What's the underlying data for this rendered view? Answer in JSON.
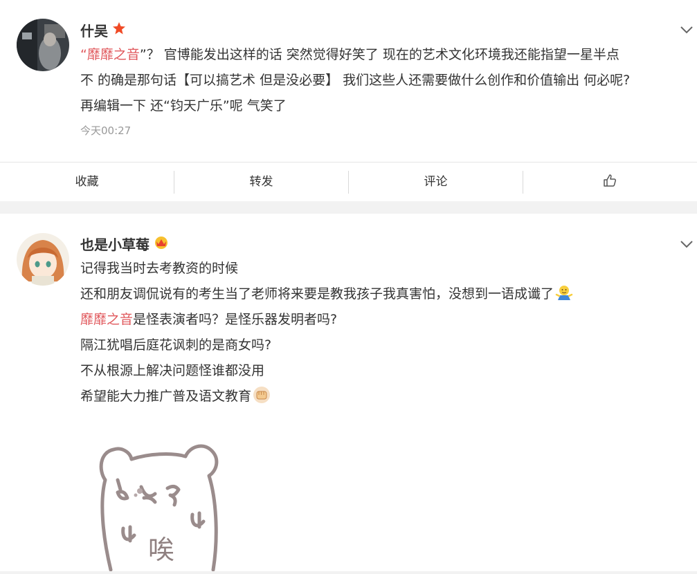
{
  "comments": [
    {
      "user": "什吴",
      "badge_icon": "star-badge-icon",
      "text_lines": [
        {
          "open_quote": "“",
          "mention": "靡靡之音",
          "rest": "”？ 官博能发出这样的话 突然觉得好笑了 现在的艺术文化环境我还能指望一星半点"
        },
        {
          "rest": "不 的确是那句话【可以搞艺术 但是没必要】 我们这些人还需要做什么创作和价值输出 何必呢?"
        },
        {
          "rest": "再编辑一下 还“钧天广乐”呢 气笑了"
        }
      ],
      "time": "今天00:27",
      "actions": {
        "collect": "收藏",
        "forward": "转发",
        "comment": "评论",
        "like_icon": "thumbs-up-icon"
      }
    },
    {
      "user": "也是小草莓",
      "badge_icon": "crown-badge-icon",
      "text_lines": [
        "记得我当时去考教资的时候",
        "还和朋友调侃说有的考生当了老师将来要是教我孩子我真害怕，没想到一语成谶了",
        {
          "mention": "靡靡之音",
          "rest": "是怪表演者吗？是怪乐器发明者吗?"
        },
        "隔江犹唱后庭花讽刺的是商女吗?",
        "不从根源上解决问题怪谁都没用",
        "希望能大力推广普及语文教育"
      ],
      "emoji_1": "shrug-emoji-icon",
      "emoji_2": "fist-emoji-icon",
      "sticker_text": "唉",
      "sticker_icon": "bear-sticker-icon"
    }
  ],
  "colors": {
    "mention": "#e0575b",
    "time": "#999999",
    "text": "#333333"
  }
}
